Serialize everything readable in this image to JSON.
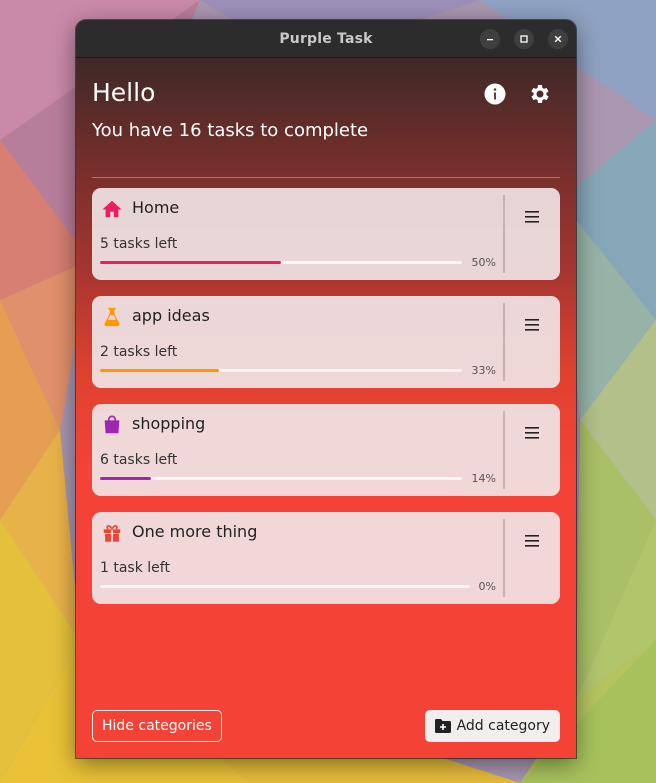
{
  "window": {
    "title": "Purple Task"
  },
  "header": {
    "greeting": "Hello",
    "subtitle": "You have 16 tasks to complete",
    "info_icon": "info-icon",
    "settings_icon": "gear-icon"
  },
  "categories": [
    {
      "name": "Home",
      "tasks_left": "5 tasks left",
      "percent_label": "50%",
      "progress": 0.5,
      "color": "#e91e63",
      "icon": "home-icon"
    },
    {
      "name": "app ideas",
      "tasks_left": "2 tasks left",
      "percent_label": "33%",
      "progress": 0.33,
      "color": "#ff9800",
      "icon": "flask-icon"
    },
    {
      "name": "shopping",
      "tasks_left": "6 tasks left",
      "percent_label": "14%",
      "progress": 0.14,
      "color": "#9c27b0",
      "icon": "shopping-bag-icon"
    },
    {
      "name": "One more thing",
      "tasks_left": "1 task left",
      "percent_label": "0%",
      "progress": 0.0,
      "color": "#f44336",
      "icon": "gift-icon"
    }
  ],
  "footer": {
    "hide_label": "Hide categories",
    "add_label": "Add category",
    "add_icon": "folder-add-icon"
  },
  "colors": {
    "accent": "#f44336",
    "titlebar": "#2c2c2c"
  }
}
